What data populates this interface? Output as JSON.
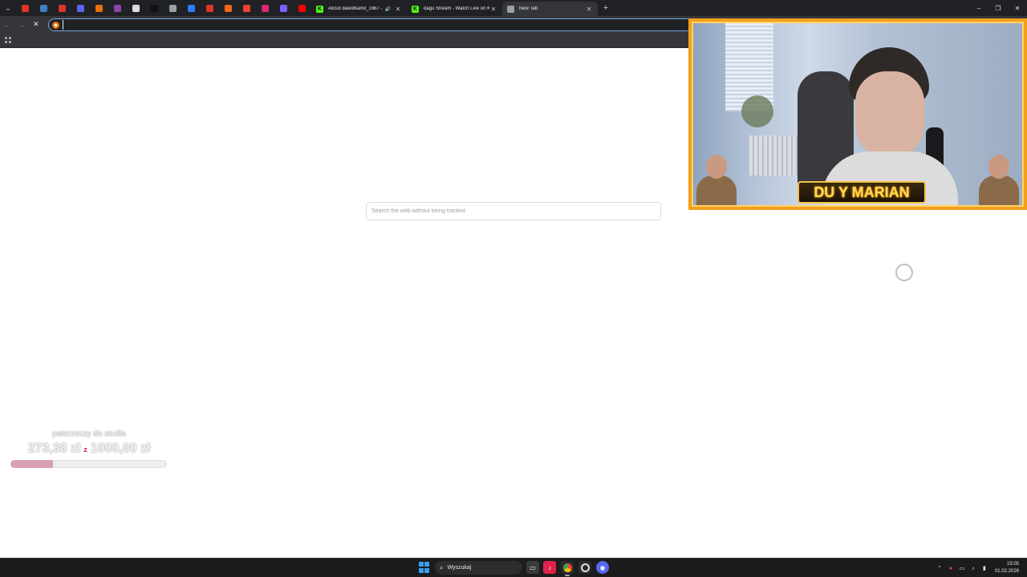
{
  "browser": {
    "pinned_tabs": [
      {
        "icon": "chevron-down-icon",
        "color": "#202124"
      },
      {
        "icon": "red-app-icon",
        "color": "#e0352b"
      },
      {
        "icon": "blue-app-icon",
        "color": "#3b82c4"
      },
      {
        "icon": "red-app-icon",
        "color": "#e0352b"
      },
      {
        "icon": "discord-icon",
        "color": "#5865f2"
      },
      {
        "icon": "orange-app-icon",
        "color": "#e8710a"
      },
      {
        "icon": "purple-app-icon",
        "color": "#8e44ad"
      },
      {
        "icon": "white-app-icon",
        "color": "#dddddd"
      },
      {
        "icon": "tiktok-icon",
        "color": "#111111"
      },
      {
        "icon": "muted-icon",
        "color": "#9aa0a6"
      },
      {
        "icon": "blue-app-icon",
        "color": "#2d7ff9"
      },
      {
        "icon": "red-app-icon",
        "color": "#e0352b"
      },
      {
        "icon": "rss-icon",
        "color": "#f26522"
      },
      {
        "icon": "gmail-icon",
        "color": "#ea4335"
      },
      {
        "icon": "instagram-icon",
        "color": "#d62976"
      },
      {
        "icon": "purple-app-icon",
        "color": "#7b61ff"
      },
      {
        "icon": "youtube-icon",
        "color": "#ff0000"
      }
    ],
    "tabs": [
      {
        "title": "About dawidkamil_1987 - Y",
        "favicon": "K",
        "favicon_color": "#53fc18",
        "audio": true,
        "active": false
      },
      {
        "title": "dagu Stream - Watch Live on Ki",
        "favicon": "K",
        "favicon_color": "#53fc18",
        "audio": false,
        "active": false
      },
      {
        "title": "New Tab",
        "favicon": "",
        "favicon_color": "#9aa0a6",
        "audio": false,
        "active": true
      }
    ],
    "omnibox_value": "",
    "page_search_placeholder": "Search the web without being tracked"
  },
  "overlay": {
    "goal_title": "patorzeczy do studia",
    "goal_current": "273,38 zł",
    "goal_sep": "z",
    "goal_target": "1000,00 zł",
    "goal_progress": 0.27,
    "accent_color": "#d81b3c",
    "webcam_nameplate": "DU  Y MARIAN",
    "frame_color": "#f2a01a"
  },
  "taskbar": {
    "search_label": "Wyszukaj",
    "time": "15:05",
    "date": "01.02.2026"
  }
}
